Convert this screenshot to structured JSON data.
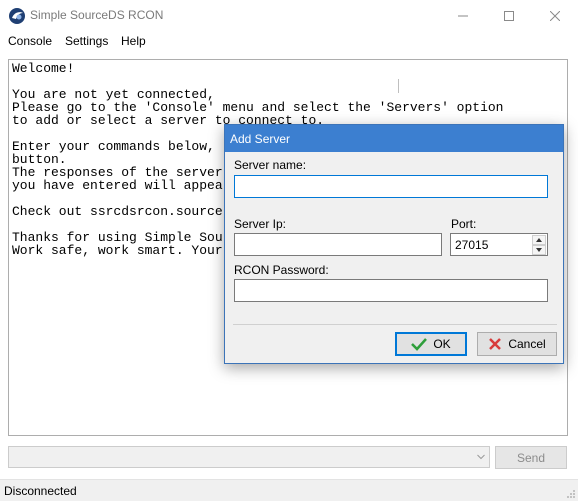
{
  "window": {
    "title": "Simple SourceDS RCON",
    "minimize_icon": "minimize-icon",
    "maximize_icon": "maximize-icon",
    "close_icon": "close-icon"
  },
  "menu": {
    "items": [
      {
        "label": "Console"
      },
      {
        "label": "Settings"
      },
      {
        "label": "Help"
      }
    ]
  },
  "console": {
    "output": "Welcome!\n\nYou are not yet connected,\nPlease go to the 'Console' menu and select the 'Servers' option\nto add or select a server to connect to.\n\nEnter your commands below,\nbutton.\nThe responses of the server\nyou have entered will appea\n\nCheck out ssrcdsrcon.source\n\nThanks for using Simple Sou\nWork safe, work smart. Your"
  },
  "command": {
    "value": "",
    "send_label": "Send"
  },
  "status": {
    "text": "Disconnected"
  },
  "dialog": {
    "title": "Add Server",
    "server_name_label": "Server name:",
    "server_name_value": "",
    "server_ip_label": "Server Ip:",
    "server_ip_value": "",
    "port_label": "Port:",
    "port_value": "27015",
    "rcon_password_label": "RCON Password:",
    "rcon_password_value": "",
    "ok_label": "OK",
    "cancel_label": "Cancel"
  },
  "colors": {
    "dialog_title_bg": "#3c7fd0",
    "ok_check": "#2e9e3a",
    "cancel_x": "#d83b3b",
    "focus_border": "#0078d7"
  }
}
